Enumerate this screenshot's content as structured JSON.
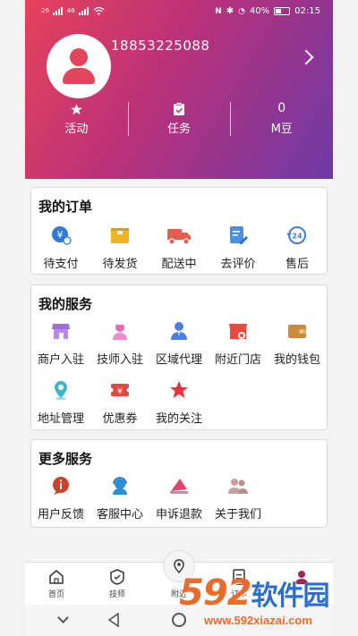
{
  "status_bar": {
    "left_labels": [
      "26",
      "46"
    ],
    "battery": "40%",
    "time": "02:15"
  },
  "profile": {
    "username": "18853225088"
  },
  "stats": [
    {
      "label": "活动",
      "value": "",
      "icon": "star-icon"
    },
    {
      "label": "任务",
      "value": "",
      "icon": "clipboard-check-icon"
    },
    {
      "label": "M豆",
      "value": "0",
      "icon": ""
    }
  ],
  "orders": {
    "title": "我的订单",
    "items": [
      {
        "label": "待支付",
        "icon": "yen-payment-icon",
        "color": "#2f7ad8"
      },
      {
        "label": "待发货",
        "icon": "package-icon",
        "color": "#f2b424"
      },
      {
        "label": "配送中",
        "icon": "truck-icon",
        "color": "#e85a4f"
      },
      {
        "label": "去评价",
        "icon": "edit-review-icon",
        "color": "#4a90e2"
      },
      {
        "label": "售后",
        "icon": "24h-service-icon",
        "color": "#3f7fd9"
      }
    ]
  },
  "services": {
    "title": "我的服务",
    "items": [
      {
        "label": "商户入驻",
        "icon": "shop-icon",
        "color": "#9b6fd6"
      },
      {
        "label": "技师入驻",
        "icon": "technician-icon",
        "color": "#e46bb7"
      },
      {
        "label": "区域代理",
        "icon": "agent-icon",
        "color": "#4a7fe0"
      },
      {
        "label": "附近门店",
        "icon": "nearby-store-icon",
        "color": "#e84b3c"
      },
      {
        "label": "我的钱包",
        "icon": "wallet-icon",
        "color": "#c98a3c"
      },
      {
        "label": "地址管理",
        "icon": "location-pin-icon",
        "color": "#3fb6c6"
      },
      {
        "label": "优惠券",
        "icon": "coupon-icon",
        "color": "#e0483e"
      },
      {
        "label": "我的关注",
        "icon": "star-favorite-icon",
        "color": "#e8343a"
      }
    ]
  },
  "more": {
    "title": "更多服务",
    "items": [
      {
        "label": "用户反馈",
        "icon": "feedback-icon",
        "color": "#c9432b"
      },
      {
        "label": "客服中心",
        "icon": "customer-service-icon",
        "color": "#2b8fd6"
      },
      {
        "label": "申诉退款",
        "icon": "refund-icon",
        "color": "#e2456a"
      },
      {
        "label": "关于我们",
        "icon": "about-us-icon",
        "color": "#c7a0a0"
      }
    ]
  },
  "tabbar": {
    "items": [
      {
        "label": "首页",
        "icon": "home-icon"
      },
      {
        "label": "技师",
        "icon": "technician-tab-icon"
      },
      {
        "label": "附近",
        "icon": "nearby-icon"
      },
      {
        "label": "订单",
        "icon": "order-icon"
      }
    ]
  },
  "watermark": {
    "logo_number": "592",
    "logo_text": "软件园",
    "url": "www.592xiazai.com"
  },
  "colors": {
    "header_start": "#e6425a",
    "header_end": "#6d3aa6",
    "accent": "#e2455c"
  }
}
